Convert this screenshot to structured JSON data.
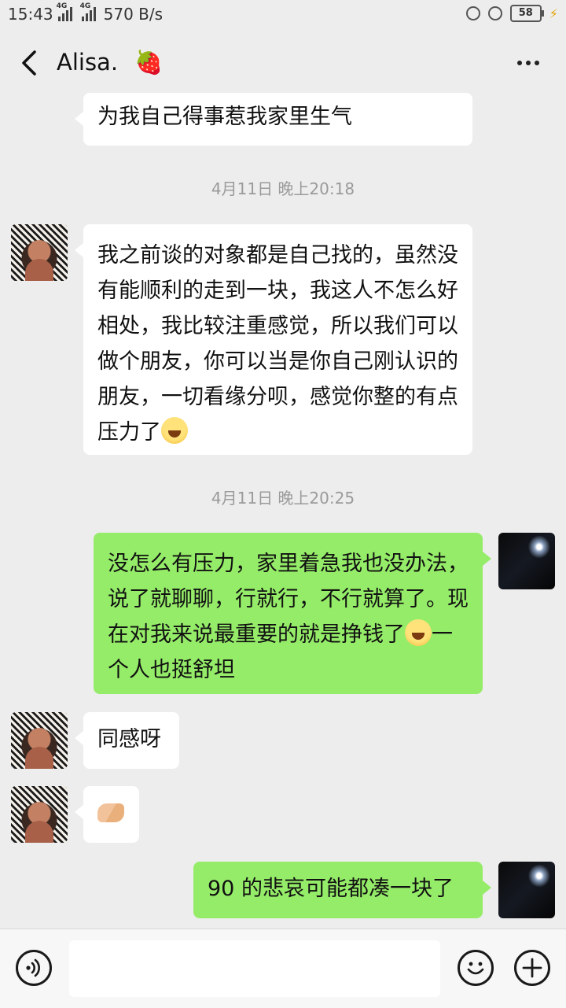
{
  "status_bar": {
    "time": "15:43",
    "network_1": "4G",
    "network_2": "4G",
    "speed": "570 B/s",
    "battery": "58"
  },
  "header": {
    "title": "Alisa.",
    "title_emoji": "🍓"
  },
  "messages": {
    "m1": {
      "sender": "them",
      "text": "为我自己得事惹我家里生气"
    },
    "t1": "4月11日 晚上20:18",
    "m2": {
      "sender": "them",
      "text": "我之前谈的对象都是自己找的，虽然没有能顺利的走到一块，我这人不怎么好相处，我比较注重感觉，所以我们可以做个朋友，你可以当是你自己刚认识的朋友，一切看缘分呗，感觉你整的有点压力了"
    },
    "t2": "4月11日 晚上20:25",
    "m3": {
      "sender": "me",
      "text_a": "没怎么有压力，家里着急我也没办法，说了就聊聊，行就行，不行就算了。现在对我来说最重要的就是挣钱了",
      "text_b": "一个人也挺舒坦"
    },
    "m4": {
      "sender": "them",
      "text": "同感呀"
    },
    "m5": {
      "sender": "them",
      "sticker": "handshake"
    },
    "m6": {
      "sender": "me",
      "text": "90 的悲哀可能都凑一块了"
    }
  },
  "input_bar": {
    "value": ""
  },
  "colors": {
    "background": "#ededed",
    "bubble_in": "#ffffff",
    "bubble_out": "#95ec69",
    "timestamp": "#9a9a9a"
  }
}
